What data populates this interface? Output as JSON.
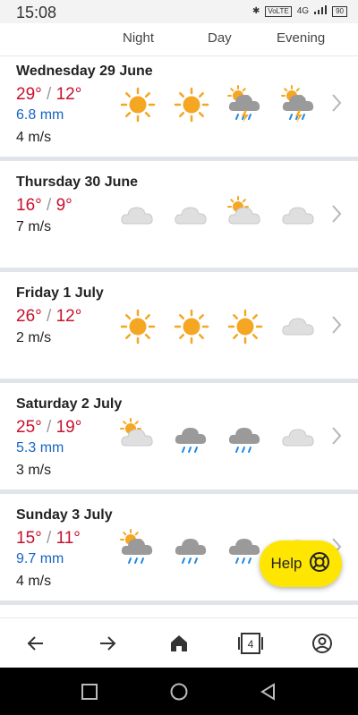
{
  "status": {
    "time": "15:08",
    "network": "4G",
    "volte": "VoLTE",
    "battery": "90"
  },
  "columns": {
    "night": "Night",
    "day": "Day",
    "evening": "Evening"
  },
  "days": [
    {
      "title": "Wednesday 29 June",
      "high": "29°",
      "low": "12°",
      "precip": "6.8 mm",
      "wind": "4 m/s",
      "icons": [
        "sun-icon",
        "sun-icon",
        "cloud-sun-thunder-rain-icon",
        "cloud-sun-thunder-rain-icon"
      ]
    },
    {
      "title": "Thursday 30 June",
      "high": "16°",
      "low": "9°",
      "precip": "",
      "wind": "7 m/s",
      "icons": [
        "cloud-icon",
        "cloud-icon",
        "partly-cloudy-icon",
        "cloud-icon"
      ]
    },
    {
      "title": "Friday 1 July",
      "high": "26°",
      "low": "12°",
      "precip": "",
      "wind": "2 m/s",
      "icons": [
        "sun-icon",
        "sun-icon",
        "sun-icon",
        "cloud-icon"
      ]
    },
    {
      "title": "Saturday 2 July",
      "high": "25°",
      "low": "19°",
      "precip": "5.3 mm",
      "wind": "3 m/s",
      "icons": [
        "partly-cloudy-icon",
        "cloud-rain-icon",
        "cloud-rain-icon",
        "cloud-icon"
      ]
    },
    {
      "title": "Sunday 3 July",
      "high": "15°",
      "low": "11°",
      "precip": "9.7 mm",
      "wind": "4 m/s",
      "icons": [
        "cloud-sun-rain-icon",
        "cloud-rain-icon",
        "cloud-rain-icon",
        "cloud-icon"
      ]
    }
  ],
  "help": {
    "label": "Help"
  },
  "bottom_nav": {
    "tab_count": "4"
  },
  "colors": {
    "temperature": "#c8102e",
    "precipitation": "#1565c0",
    "help_button": "#ffe600"
  }
}
